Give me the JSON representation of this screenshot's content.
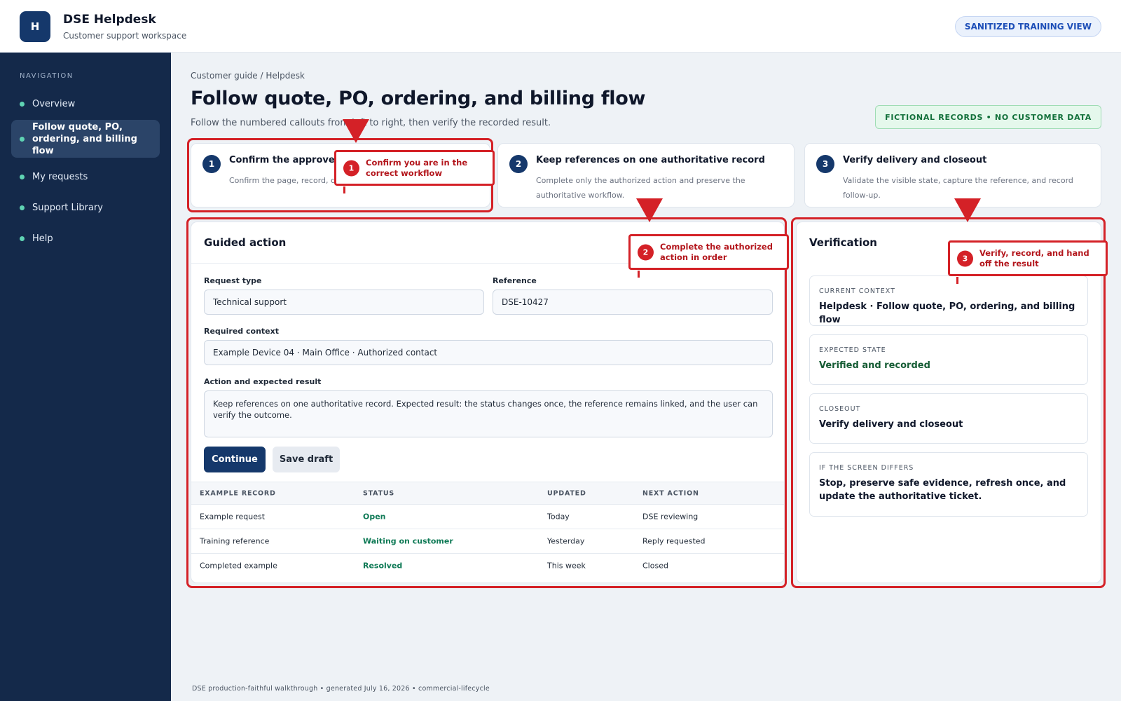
{
  "app": {
    "logo_letter": "H",
    "title": "DSE Helpdesk",
    "subtitle": "Customer support workspace",
    "mode_badge": "SANITIZED TRAINING VIEW"
  },
  "sidebar": {
    "heading": "NAVIGATION",
    "items": [
      {
        "label": "Overview"
      },
      {
        "label": "Follow quote, PO, ordering, and billing flow"
      },
      {
        "label": "My requests"
      },
      {
        "label": "Support Library"
      },
      {
        "label": "Help"
      }
    ]
  },
  "main": {
    "breadcrumb": "Customer guide / Helpdesk",
    "title": "Follow quote, PO, ordering, and billing flow",
    "subtitle": "Follow the numbered callouts from left to right, then verify the recorded result.",
    "data_badge": "FICTIONAL RECORDS • NO CUSTOMER DATA"
  },
  "steps": [
    {
      "number": "1",
      "title": "Confirm the approved request",
      "desc": "Confirm the page, record, company, and reference."
    },
    {
      "number": "2",
      "title": "Keep references on one authoritative record",
      "desc": "Complete only the authorized action and preserve the authoritative workflow."
    },
    {
      "number": "3",
      "title": "Verify delivery and closeout",
      "desc": "Validate the visible state, capture the reference, and record follow-up."
    }
  ],
  "guided": {
    "title": "Guided action",
    "request_type_label": "Request type",
    "request_type_value": "Technical support",
    "reference_label": "Reference",
    "reference_value": "DSE-10427",
    "context_label": "Required context",
    "context_value": "Example Device 04 · Main Office · Authorized contact",
    "action_label": "Action and expected result",
    "action_value": "Keep references on one authoritative record. Expected result: the status changes once, the reference remains linked, and the user can verify the outcome.",
    "continue_label": "Continue",
    "save_label": "Save draft"
  },
  "table": {
    "headers": [
      "EXAMPLE RECORD",
      "STATUS",
      "UPDATED",
      "NEXT ACTION"
    ],
    "rows": [
      {
        "record": "Example request",
        "status": "Open",
        "updated": "Today",
        "next": "DSE reviewing"
      },
      {
        "record": "Training reference",
        "status": "Waiting on customer",
        "updated": "Yesterday",
        "next": "Reply requested"
      },
      {
        "record": "Completed example",
        "status": "Resolved",
        "updated": "This week",
        "next": "Closed"
      }
    ]
  },
  "verification": {
    "title": "Verification",
    "cards": [
      {
        "label": "CURRENT CONTEXT",
        "value": "Helpdesk · Follow quote, PO, ordering, and billing flow"
      },
      {
        "label": "EXPECTED STATE",
        "value": "Verified and recorded"
      },
      {
        "label": "CLOSEOUT",
        "value": "Verify delivery and closeout"
      },
      {
        "label": "IF THE SCREEN DIFFERS",
        "value": "Stop, preserve safe evidence, refresh once, and update the authoritative ticket."
      }
    ]
  },
  "callouts": [
    {
      "number": "1",
      "text": "Confirm you are in the correct workflow"
    },
    {
      "number": "2",
      "text": "Complete the authorized action in order"
    },
    {
      "number": "3",
      "text": "Verify, record, and hand off the result"
    }
  ],
  "footer": "DSE production-faithful walkthrough • generated July 16, 2026 • commercial-lifecycle",
  "colors": {
    "brand": "#15386b",
    "sidebar": "#14294a",
    "annotation": "#d42127",
    "status_green": "#0f7a56"
  }
}
